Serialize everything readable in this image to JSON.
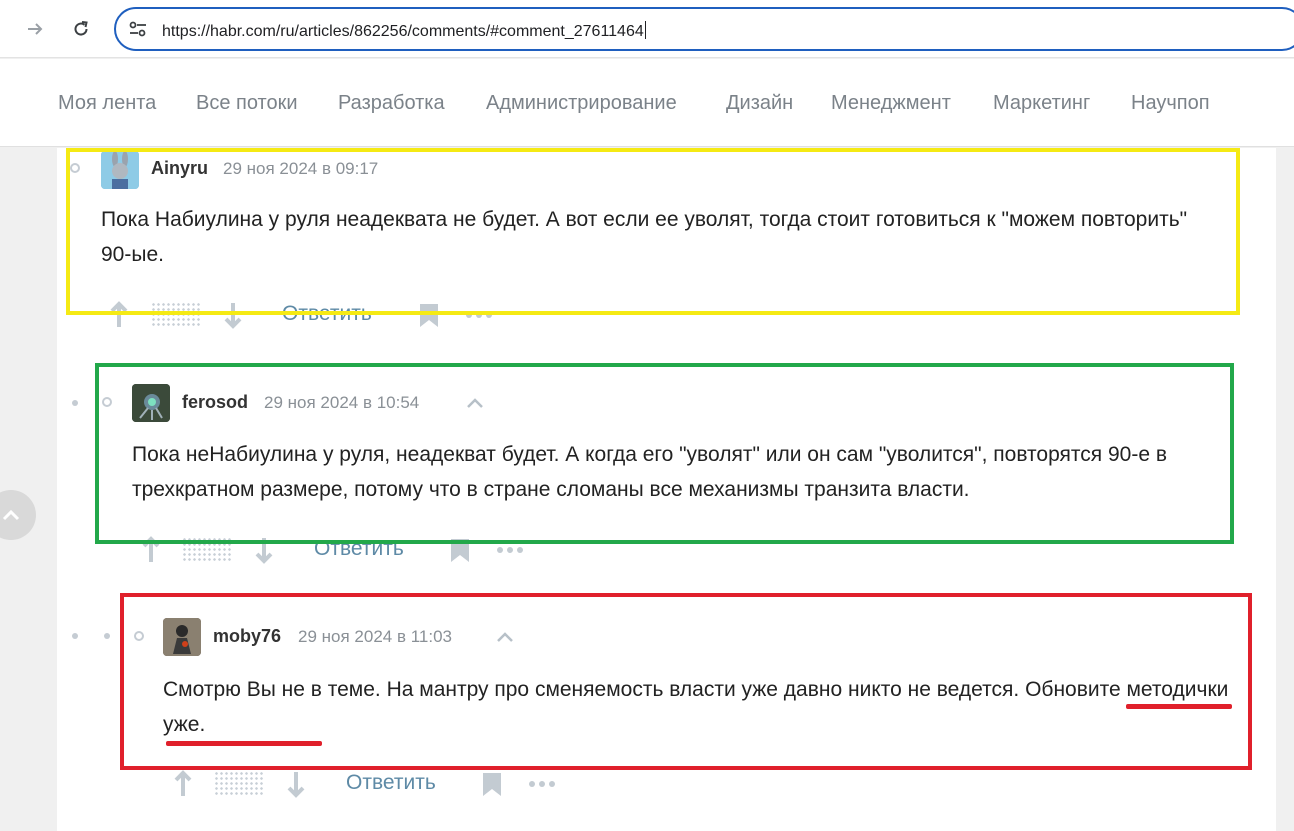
{
  "browser": {
    "url": "https://habr.com/ru/articles/862256/comments/#comment_27611464",
    "back_icon": "arrow-right-icon",
    "reload_icon": "reload-icon",
    "site_info_icon": "tune-icon"
  },
  "hubs": [
    "Моя лента",
    "Все потоки",
    "Разработка",
    "Администрирование",
    "Дизайн",
    "Менеджмент",
    "Маркетинг",
    "Научпоп"
  ],
  "comments": [
    {
      "author": "Ainyru",
      "date": "29 ноя 2024 в 09:17",
      "text": "Пока Набиулина у руля неадеквата не будет. А вот если ее уволят, тогда стоит готовиться к \"можем повторить\" 90-ые.",
      "reply_label": "Ответить",
      "highlight_color": "#f5ea14"
    },
    {
      "author": "ferosod",
      "date": "29 ноя 2024 в 10:54",
      "text": "Пока неНабиулина у руля, неадекват будет. А когда его \"уволят\" или он сам \"уволится\", повторятся 90-е в трехкратном размере, потому что в стране сломаны все механизмы транзита власти.",
      "reply_label": "Ответить",
      "highlight_color": "#22a84a"
    },
    {
      "author": "moby76",
      "date": "29 ноя 2024 в 11:03",
      "text_main": "Смотрю Вы не в теме. На мантру про сменяемость власти уже давно никто не ведется.",
      "text_highlight": "Обновите методички уже",
      "text_end": ".",
      "reply_label": "Ответить",
      "highlight_color": "#e0202b"
    }
  ]
}
